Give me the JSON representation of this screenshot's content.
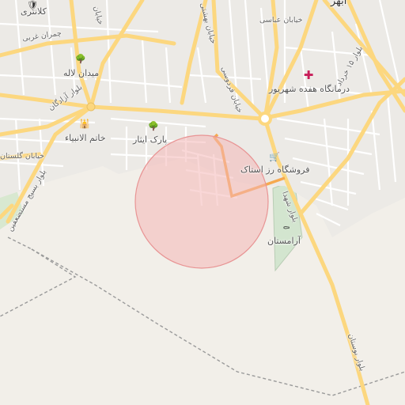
{
  "map": {
    "labels": {
      "top_city": "ابهر",
      "kalantari": "کلانتری",
      "chamran": "چمران غربی",
      "meydan_laleh": "میدان لاله",
      "blvd_azadegan": "بلوار آزادگان",
      "khatam": "خاتم الانبیاء",
      "park_isar": "پارک ایثار",
      "kh_golestan": "خیابان گلستان",
      "blvd_basij": "بلوار بسیج مستضعفین",
      "kh_abbasi": "خیابان عباسی",
      "kh_ferdowsi": "خیابان فردوسی",
      "kh_beheshti": "خیابان بهشتی",
      "kh_khayyam": "خیابان",
      "darmangah": "درمانگاه هفده شهریور",
      "blvd_15khordad": "بلوار ۱۵ خرداد",
      "rozostak": "فروشگاه رز استاک",
      "blvd_shohada": "بلوار شهدا",
      "aramestan": "آرامستان",
      "blvd_bostan": "بلوار بوستان"
    },
    "icons": {
      "police": "police-icon",
      "park1": "tree-icon",
      "park2": "tree-icon",
      "shrine": "mosque-icon",
      "hospital": "hospital-icon",
      "shop": "shopping-cart-icon",
      "cemetery": "cemetery-icon"
    },
    "colors": {
      "background": "#f2efe9",
      "major_road": "#fcd77f",
      "minor_road": "#ffffff",
      "search_circle": "#f4b6b6",
      "route": "#f6a94f",
      "boundary": "#9a9a9a"
    }
  }
}
